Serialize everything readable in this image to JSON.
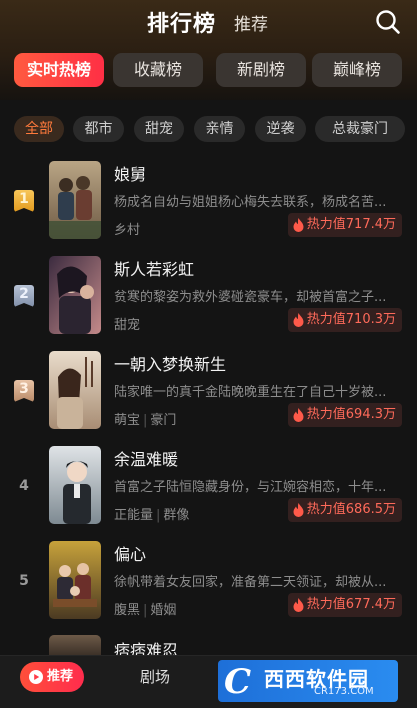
{
  "header": {
    "title": "排行榜",
    "subtitle": "推荐"
  },
  "tabs": [
    {
      "label": "实时热榜",
      "active": true
    },
    {
      "label": "收藏榜",
      "active": false
    },
    {
      "label": "新剧榜",
      "active": false
    },
    {
      "label": "巅峰榜",
      "active": false
    }
  ],
  "chips": [
    {
      "label": "全部",
      "active": true
    },
    {
      "label": "都市",
      "active": false
    },
    {
      "label": "甜宠",
      "active": false
    },
    {
      "label": "亲情",
      "active": false
    },
    {
      "label": "逆袭",
      "active": false
    },
    {
      "label": "总裁豪门",
      "active": false
    }
  ],
  "dramas": [
    {
      "rank": "1",
      "title": "娘舅",
      "desc": "杨成名自幼与姐姐杨心梅失去联系，杨成名苦...",
      "tags": [
        "乡村"
      ],
      "heat": "热力值717.4万"
    },
    {
      "rank": "2",
      "title": "斯人若彩虹",
      "desc": "贫寒的黎姿为救外婆碰瓷豪车，却被首富之子...",
      "tags": [
        "甜宠"
      ],
      "heat": "热力值710.3万"
    },
    {
      "rank": "3",
      "title": "一朝入梦换新生",
      "desc": "陆家唯一的真千金陆晚晚重生在了自己十岁被...",
      "tags": [
        "萌宝",
        "豪门"
      ],
      "heat": "热力值694.3万"
    },
    {
      "rank": "4",
      "title": "余温难暖",
      "desc": "首富之子陆恒隐藏身份，与江婉容相恋，十年...",
      "tags": [
        "正能量",
        "群像"
      ],
      "heat": "热力值686.5万"
    },
    {
      "rank": "5",
      "title": "偏心",
      "desc": "徐帆带着女友回家，准备第二天领证，却被从...",
      "tags": [
        "腹黑",
        "婚姻"
      ],
      "heat": "热力值677.4万"
    }
  ],
  "partial_item": {
    "title": "痞痞难忍"
  },
  "bottom_nav": {
    "recommend": "推荐",
    "theater": "剧场"
  },
  "watermark": {
    "text": "西西软件园",
    "url": "CR173.COM"
  },
  "colors": {
    "accent": "#ff3b45",
    "heat_text": "#ff6a5a",
    "background": "#141414"
  }
}
